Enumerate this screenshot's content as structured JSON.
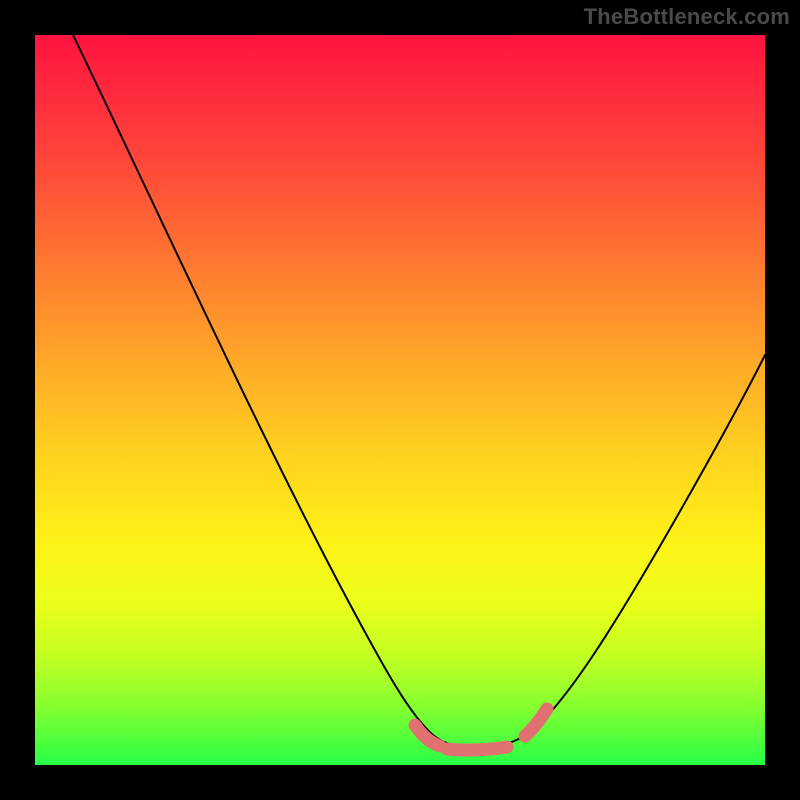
{
  "watermark": "TheBottleneck.com",
  "colors": {
    "background": "#000000",
    "gradient_top": "#ff143f",
    "gradient_bottom": "#26ff47",
    "curve": "#000000",
    "marker": "#e17070"
  },
  "chart_data": {
    "type": "line",
    "title": "",
    "xlabel": "",
    "ylabel": "",
    "xlim": [
      0,
      100
    ],
    "ylim": [
      0,
      100
    ],
    "x": [
      0,
      10,
      20,
      30,
      40,
      48,
      52,
      56,
      60,
      64,
      70,
      80,
      90,
      100
    ],
    "values": [
      100,
      84,
      68,
      52,
      36,
      16,
      6,
      2,
      1,
      2,
      6,
      22,
      40,
      58
    ],
    "optimal_band_x": [
      52,
      66
    ],
    "annotations": []
  }
}
